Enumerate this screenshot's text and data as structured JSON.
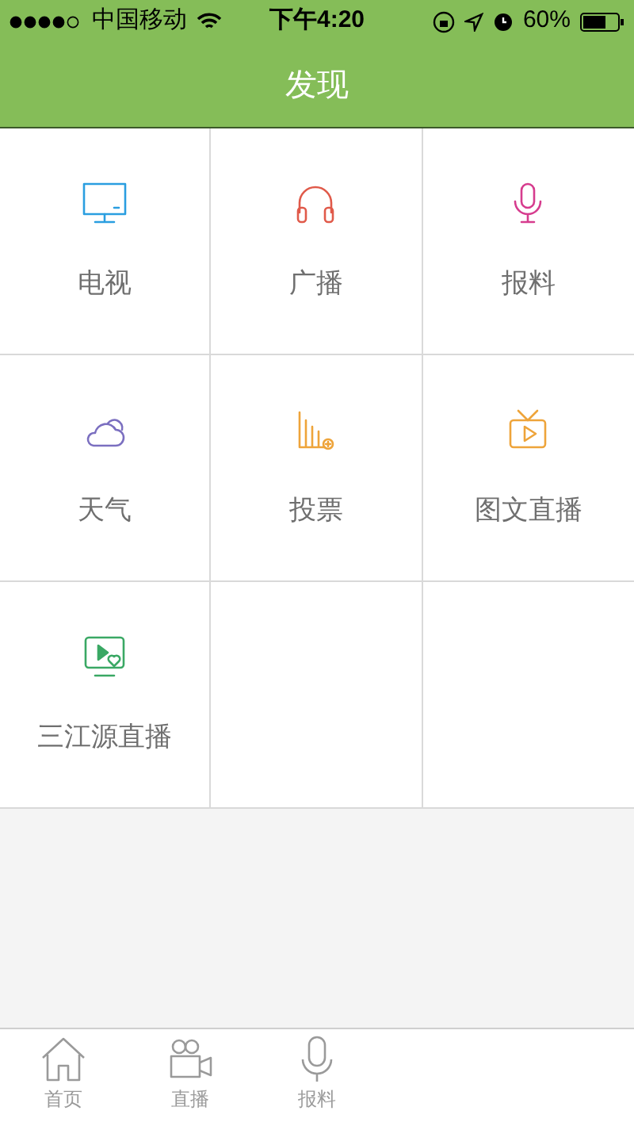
{
  "status_bar": {
    "carrier": "中国移动",
    "time": "下午4:20",
    "battery": "60%"
  },
  "nav_bar": {
    "title": "发现"
  },
  "grid": [
    {
      "label": "电视",
      "color": "#2a9ee0"
    },
    {
      "label": "广播",
      "color": "#e05a4a"
    },
    {
      "label": "报料",
      "color": "#d63c8e"
    },
    {
      "label": "天气",
      "color": "#7b6fc0"
    },
    {
      "label": "投票",
      "color": "#eea43a"
    },
    {
      "label": "图文直播",
      "color": "#eea43a"
    },
    {
      "label": "三江源直播",
      "color": "#3aa864"
    }
  ],
  "tab_bar": [
    {
      "label": "首页"
    },
    {
      "label": "直播"
    },
    {
      "label": "报料"
    }
  ]
}
